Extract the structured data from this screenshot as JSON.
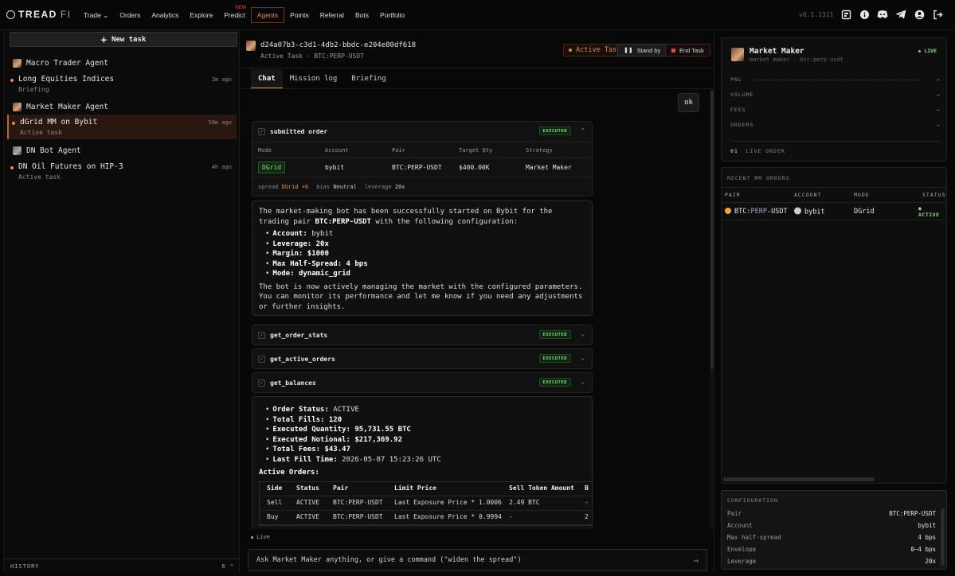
{
  "brand": {
    "name_main": "TREAD",
    "name_sub": "FI"
  },
  "nav": {
    "items": [
      "Trade",
      "Orders",
      "Analytics",
      "Explore",
      "Predict",
      "Agents",
      "Points",
      "Referral",
      "Bots",
      "Portfolio"
    ],
    "new_badge": "NEW",
    "active": "Agents"
  },
  "version": "v6.1.1311",
  "sidebar": {
    "new_task_label": "New task",
    "groups": [
      {
        "agent": "Macro Trader Agent",
        "tasks": [
          {
            "title": "Long Equities Indices",
            "sub": "Briefing",
            "ago": "2m ago"
          }
        ]
      },
      {
        "agent": "Market Maker Agent",
        "tasks": [
          {
            "title": "dGrid MM on Bybit",
            "sub": "Active task",
            "ago": "50m ago"
          }
        ]
      },
      {
        "agent": "DN Bot Agent",
        "tasks": [
          {
            "title": "DN Oil Futures on HIP-3",
            "sub": "Active task",
            "ago": "4h ago"
          }
        ]
      }
    ],
    "history_label": "HISTORY",
    "history_count": "6"
  },
  "main": {
    "task_id": "d24a07b3-c3d1-4db2-bbdc-e204e80df618",
    "task_sub": "Active Task · BTC:PERP-USDT",
    "status_label": "Active Task",
    "standby_label": "Stand by",
    "end_label": "End Task",
    "tabs": [
      "Chat",
      "Mission log",
      "Briefing"
    ],
    "user_msg": "ok",
    "order_card": {
      "title": "submitted order",
      "status": "EXECUTED",
      "headers": [
        "Mode",
        "Account",
        "Pair",
        "Target Qty",
        "Strategy"
      ],
      "row": {
        "mode": "DGrid",
        "account": "bybit",
        "pair": "BTC:PERP-USDT",
        "qty_main": "$400.00",
        "qty_unit": "K",
        "strategy": "Market Maker"
      },
      "meta": {
        "spread_label": "spread",
        "spread_val": "DGrid +6",
        "bias_label": "bias",
        "bias_val": "Neutral",
        "lev_label": "leverage",
        "lev_val": "20x"
      }
    },
    "msg1": {
      "p1_a": "The market-making bot has been successfully started on Bybit for the trading pair ",
      "p1_pair": "BTC:PERP-USDT",
      "p1_b": " with the following configuration:",
      "items": [
        {
          "k": "Account:",
          "v": "bybit"
        },
        {
          "k": "Leverage:",
          "v": "20x"
        },
        {
          "k": "Margin:",
          "v": "$1000"
        },
        {
          "k": "Max Half-Spread:",
          "v": "4 bps"
        },
        {
          "k": "Mode:",
          "v": "dynamic_grid"
        }
      ],
      "p2": "The bot is now actively managing the market with the configured parameters. You can monitor its performance and let me know if you need any adjustments or further insights."
    },
    "tools": [
      {
        "name": "get_order_stats",
        "status": "EXECUTED"
      },
      {
        "name": "get_active_orders",
        "status": "EXECUTED"
      },
      {
        "name": "get_balances",
        "status": "EXECUTED"
      }
    ],
    "msg2": {
      "items": [
        {
          "k": "Order Status:",
          "v": "ACTIVE"
        },
        {
          "k": "Total Fills:",
          "v": "120"
        },
        {
          "k": "Executed Quantity:",
          "v": "95,731.55 BTC"
        },
        {
          "k": "Executed Notional:",
          "v": "$217,369.92"
        },
        {
          "k": "Total Fees:",
          "v": "$43.47"
        },
        {
          "k": "Last Fill Time:",
          "v": "2026-05-07 15:23:26 UTC"
        }
      ],
      "orders_title": "Active Orders:",
      "headers": [
        "Side",
        "Status",
        "Pair",
        "Limit Price",
        "Sell Token Amount",
        "B"
      ],
      "rows": [
        [
          "Sell",
          "ACTIVE",
          "BTC:PERP-USDT",
          "Last Exposure Price * 1.0006",
          "2.49 BTC",
          "-"
        ],
        [
          "Buy",
          "ACTIVE",
          "BTC:PERP-USDT",
          "Last Exposure Price * 0.9994",
          "-",
          "2"
        ]
      ]
    },
    "live_label": "Live",
    "input_placeholder": "Ask Market Maker anything, or give a command (\"widen the spread\")"
  },
  "right": {
    "agent_name": "Market Maker",
    "agent_sub": "market maker · btc:perp-usdt",
    "live_label": "LIVE",
    "stats": [
      {
        "label": "PNL",
        "value": "—"
      },
      {
        "label": "VOLUME",
        "value": "—"
      },
      {
        "label": "FEES",
        "value": "—"
      },
      {
        "label": "ORDERS",
        "value": "—"
      }
    ],
    "live_order_count": "01",
    "live_order_label": "LIVE ORDER",
    "recent_title": "RECENT MM ORDERS",
    "recent_headers": [
      "PAIR",
      "ACCOUNT",
      "MODE",
      "STATUS"
    ],
    "recent_row": {
      "pair_a": "BTC:",
      "pair_b": "PERP",
      "pair_c": "-USDT",
      "account": "bybit",
      "mode": "DGrid",
      "status": "ACTIVE"
    },
    "config_title": "CONFIGURATION",
    "config": [
      {
        "k": "Pair",
        "v": "BTC:PERP-USDT"
      },
      {
        "k": "Account",
        "v": "bybit"
      },
      {
        "k": "Max half-spread",
        "v": "4 bps"
      },
      {
        "k": "Envelope",
        "v": "0–4 bps"
      },
      {
        "k": "Leverage",
        "v": "20x"
      }
    ]
  },
  "colors": {
    "accent": "#e08a52",
    "success": "#8fd58f",
    "danger": "#e24b3b"
  }
}
